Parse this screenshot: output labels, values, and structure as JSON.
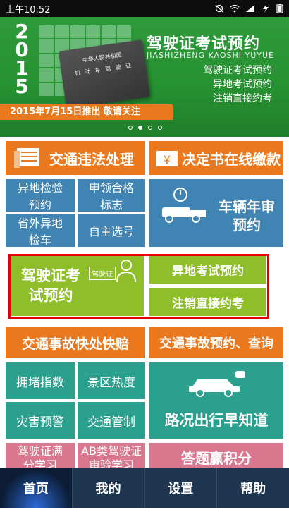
{
  "status": {
    "time": "上午10:52"
  },
  "banner": {
    "year_digits": [
      "2",
      "0",
      "1",
      "5"
    ],
    "card_line1": "中华人民共和国",
    "card_line2": "机 动 车 驾 驶 证",
    "title_cn": "驾驶证考试预约",
    "title_en": "JIASHIZHENG  KAOSHI  YUYUE",
    "bullets": [
      "驾驶证考试预约",
      "异地考试预约",
      "注销直接约考"
    ],
    "notice": "2015年7月15日推出   敬请关注",
    "page_count": 4,
    "active_page": 1
  },
  "tiles": {
    "traffic_violation": "交通违法处理",
    "decision_payment": "决定书在线缴款",
    "remote_inspection": "异地检验预约",
    "apply_label": "申领合格标志",
    "out_of_province": "省外异地检车",
    "self_plate": "自主选号",
    "annual_review": "车辆年审预约",
    "license_exam": "驾驶证考试预约",
    "license_badge": "驾驶证",
    "remote_exam": "异地考试预约",
    "cancel_exam": "注销直接约考",
    "accident_quick": "交通事故快处快赔",
    "accident_query": "交通事故预约、查询",
    "congestion": "拥堵指数",
    "scenic_heat": "景区热度",
    "disaster_warning": "灾害预警",
    "traffic_control": "交通管制",
    "road_status": "路况出行早知道",
    "license_points": "驾驶证满分学习",
    "ab_class": "AB类驾驶证审验学习",
    "quiz_points": "答题赢积分"
  },
  "tabbar": {
    "items": [
      "首页",
      "我的",
      "设置",
      "帮助"
    ],
    "active": 0
  }
}
